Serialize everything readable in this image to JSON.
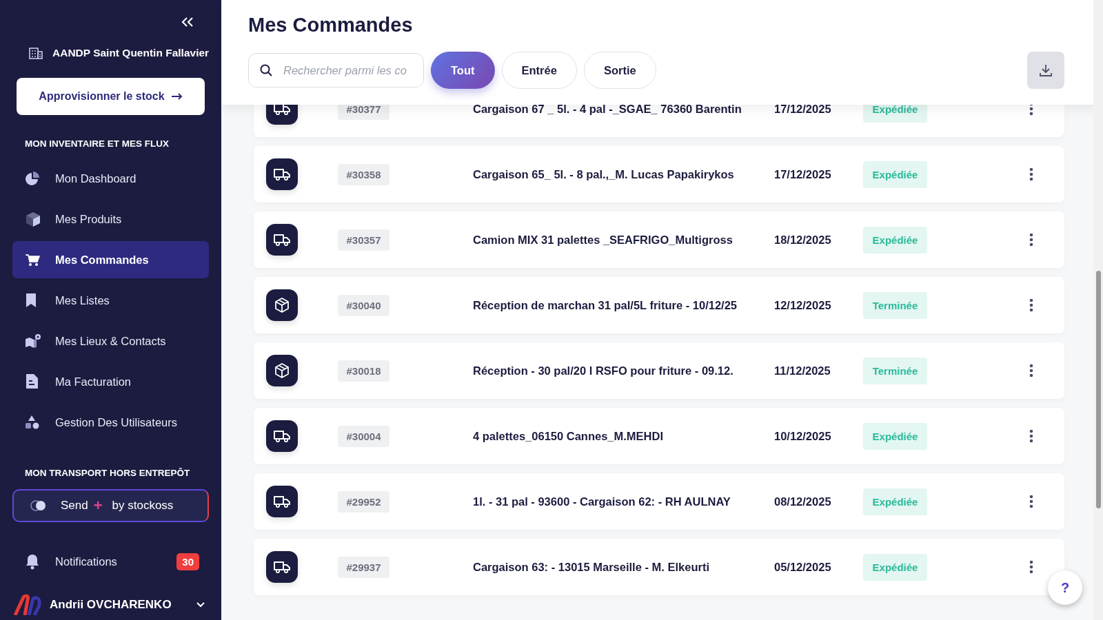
{
  "sidebar": {
    "company": "AANDP Saint Quentin Fallavier",
    "supply_button": "Approvisionner le stock",
    "sections": [
      {
        "heading": "MON INVENTAIRE ET MES FLUX",
        "items": [
          {
            "label": "Mon Dashboard",
            "kind": "pie",
            "selected": false
          },
          {
            "label": "Mes Produits",
            "kind": "cube",
            "selected": false
          },
          {
            "label": "Mes Commandes",
            "kind": "cart",
            "selected": true
          },
          {
            "label": "Mes Listes",
            "kind": "bookmark",
            "selected": false
          },
          {
            "label": "Mes Lieux & Contacts",
            "kind": "map",
            "selected": false
          },
          {
            "label": "Ma Facturation",
            "kind": "document",
            "selected": false
          },
          {
            "label": "Gestion Des Utilisateurs",
            "kind": "shapes",
            "selected": false
          }
        ]
      },
      {
        "heading": "MON TRANSPORT HORS ENTREPÔT"
      }
    ],
    "send_button": {
      "label_start": "Send",
      "plus": "+",
      "label_end": "by stockoss"
    },
    "notifications": {
      "label": "Notifications",
      "count": "30"
    },
    "user": {
      "name": "Andrii OVCHARENKO"
    }
  },
  "page": {
    "title": "Mes Commandes",
    "search": {
      "placeholder": "Rechercher parmi les co"
    },
    "filters": [
      {
        "label": "Tout",
        "selected": true
      },
      {
        "label": "Entrée",
        "selected": false
      },
      {
        "label": "Sortie",
        "selected": false
      }
    ]
  },
  "orders": [
    {
      "kind": "truck",
      "id": "#30377",
      "description": "Cargaison 67 _ 5l. - 4 pal -_SGAE_ 76360 Barentin",
      "date": "17/12/2025",
      "status": "Expédiée"
    },
    {
      "kind": "truck",
      "id": "#30358",
      "description": "Cargaison 65_ 5l. - 8 pal.,_M. Lucas Papakirykos",
      "date": "17/12/2025",
      "status": "Expédiée"
    },
    {
      "kind": "truck",
      "id": "#30357",
      "description": "Camion MIX 31 palettes _SEAFRIGO_Multigross",
      "date": "18/12/2025",
      "status": "Expédiée"
    },
    {
      "kind": "box",
      "id": "#30040",
      "description": "Réception de marchan 31 pal/5L friture - 10/12/25",
      "date": "12/12/2025",
      "status": "Terminée"
    },
    {
      "kind": "box",
      "id": "#30018",
      "description": "Réception - 30 pal/20 l RSFO pour friture - 09.12.",
      "date": "11/12/2025",
      "status": "Terminée"
    },
    {
      "kind": "truck",
      "id": "#30004",
      "description": "4 palettes_06150 Cannes_M.MEHDI",
      "date": "10/12/2025",
      "status": "Expédiée"
    },
    {
      "kind": "truck",
      "id": "#29952",
      "description": "1l. - 31 pal - 93600 - Cargaison 62: - RH AULNAY",
      "date": "08/12/2025",
      "status": "Expédiée"
    },
    {
      "kind": "truck",
      "id": "#29937",
      "description": "Cargaison 63: - 13015 Marseille - M. Elkeurti",
      "date": "05/12/2025",
      "status": "Expédiée"
    }
  ],
  "help_button": "?"
}
